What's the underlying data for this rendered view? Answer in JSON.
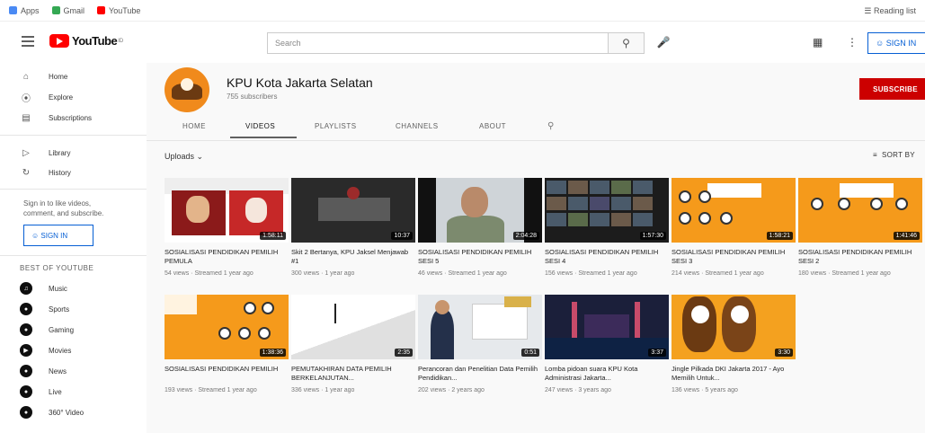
{
  "bookmarks": {
    "items": [
      "Apps",
      "Gmail",
      "YouTube"
    ],
    "right_label": "Reading list"
  },
  "topbar": {
    "logo_text": "YouTube",
    "logo_region": "ID",
    "search_placeholder": "Search",
    "signin_label": "SIGN IN"
  },
  "sidebar": {
    "main_items": [
      {
        "label": "Home",
        "icon": "home-icon"
      },
      {
        "label": "Explore",
        "icon": "compass-icon"
      },
      {
        "label": "Subscriptions",
        "icon": "subscriptions-icon"
      }
    ],
    "library_items": [
      {
        "label": "Library",
        "icon": "library-icon"
      },
      {
        "label": "History",
        "icon": "history-icon"
      }
    ],
    "signin_prompt": "Sign in to like videos, comment, and subscribe.",
    "signin_label": "SIGN IN",
    "best_heading": "BEST OF YOUTUBE",
    "best_items": [
      "Music",
      "Sports",
      "Gaming",
      "Movies",
      "News",
      "Live",
      "360° Video"
    ]
  },
  "channel": {
    "name": "KPU Kota Jakarta Selatan",
    "subscribers": "755 subscribers",
    "subscribe_label": "SUBSCRIBE",
    "tabs": [
      "HOME",
      "VIDEOS",
      "PLAYLISTS",
      "CHANNELS",
      "ABOUT"
    ],
    "active_tab": "VIDEOS"
  },
  "section": {
    "uploads_label": "Uploads",
    "sort_label": "SORT BY"
  },
  "videos": [
    {
      "title": "SOSIALISASI PENDIDIKAN PEMILIH PEMULA",
      "meta": "54 views · Streamed 1 year ago",
      "duration": "1:58:11"
    },
    {
      "title": "Skit 2 Bertanya, KPU Jaksel Menjawab #1",
      "meta": "300 views · 1 year ago",
      "duration": "10:37"
    },
    {
      "title": "SOSIALISASI PENDIDIKAN PEMILIH SESI 5",
      "meta": "46 views · Streamed 1 year ago",
      "duration": "2:04:28"
    },
    {
      "title": "SOSIALISASI PENDIDIKAN PEMILIH SESI 4",
      "meta": "156 views · Streamed 1 year ago",
      "duration": "1:57:30"
    },
    {
      "title": "SOSIALISASI PENDIDIKAN PEMILIH SESI 3",
      "meta": "214 views · Streamed 1 year ago",
      "duration": "1:58:21"
    },
    {
      "title": "SOSIALISASI PENDIDIKAN PEMILIH SESI 2",
      "meta": "180 views · Streamed 1 year ago",
      "duration": "1:41:46"
    },
    {
      "title": "SOSIALISASI PENDIDIKAN PEMILIH",
      "meta": "193 views · Streamed 1 year ago",
      "duration": "1:38:36"
    },
    {
      "title": "PEMUTAKHIRAN DATA PEMILIH BERKELANJUTAN...",
      "meta": "336 views · 1 year ago",
      "duration": "2:35"
    },
    {
      "title": "Perancoran dan Penelitian Data Pemilih Pendidikan...",
      "meta": "202 views · 2 years ago",
      "duration": "0:51"
    },
    {
      "title": "Lomba pidoan suara KPU Kota Administrasi Jakarta...",
      "meta": "247 views · 3 years ago",
      "duration": "3:37"
    },
    {
      "title": "Jingle Pilkada DKI Jakarta 2017 - Ayo Memilih Untuk...",
      "meta": "136 views · 5 years ago",
      "duration": "3:30"
    }
  ]
}
